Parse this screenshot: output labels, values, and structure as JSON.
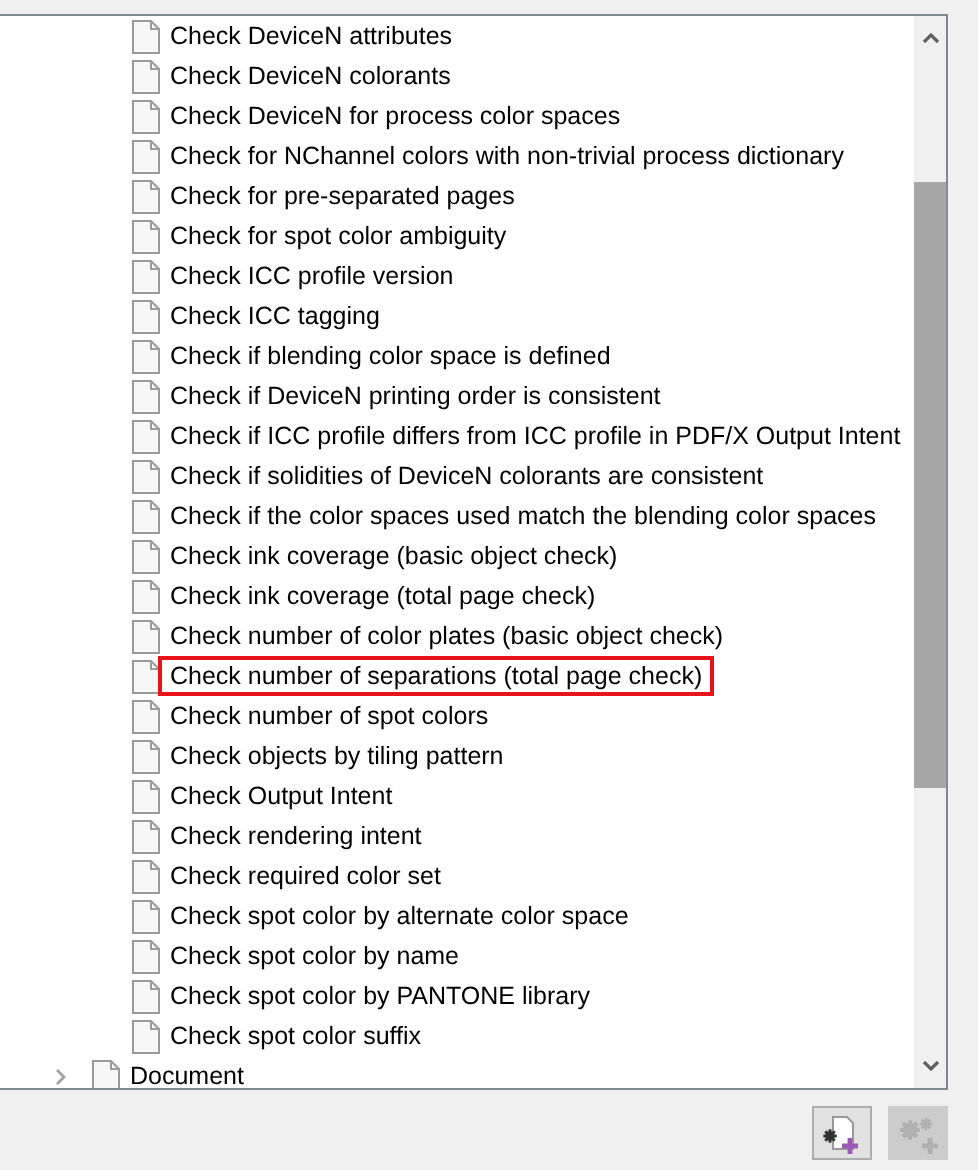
{
  "tree": {
    "items": [
      {
        "kind": "leaf",
        "label": "Check DeviceN attributes",
        "highlighted": false
      },
      {
        "kind": "leaf",
        "label": "Check DeviceN colorants",
        "highlighted": false
      },
      {
        "kind": "leaf",
        "label": "Check DeviceN for process color spaces",
        "highlighted": false
      },
      {
        "kind": "leaf",
        "label": "Check for NChannel colors with non-trivial process dictionary",
        "highlighted": false
      },
      {
        "kind": "leaf",
        "label": "Check for pre-separated pages",
        "highlighted": false
      },
      {
        "kind": "leaf",
        "label": "Check for spot color ambiguity",
        "highlighted": false
      },
      {
        "kind": "leaf",
        "label": "Check ICC profile version",
        "highlighted": false
      },
      {
        "kind": "leaf",
        "label": "Check ICC tagging",
        "highlighted": false
      },
      {
        "kind": "leaf",
        "label": "Check if blending color space is defined",
        "highlighted": false
      },
      {
        "kind": "leaf",
        "label": "Check if DeviceN printing order is consistent",
        "highlighted": false
      },
      {
        "kind": "leaf",
        "label": "Check if ICC profile differs from ICC profile in PDF/X Output Intent",
        "highlighted": false
      },
      {
        "kind": "leaf",
        "label": "Check if solidities of DeviceN colorants are consistent",
        "highlighted": false
      },
      {
        "kind": "leaf",
        "label": "Check if the color spaces used match the blending color spaces",
        "highlighted": false
      },
      {
        "kind": "leaf",
        "label": "Check ink coverage (basic object check)",
        "highlighted": false
      },
      {
        "kind": "leaf",
        "label": "Check ink coverage (total page check)",
        "highlighted": false
      },
      {
        "kind": "leaf",
        "label": "Check number of color plates (basic object check)",
        "highlighted": false
      },
      {
        "kind": "leaf",
        "label": "Check number of separations (total page check)",
        "highlighted": true
      },
      {
        "kind": "leaf",
        "label": "Check number of spot colors",
        "highlighted": false
      },
      {
        "kind": "leaf",
        "label": "Check objects by tiling pattern",
        "highlighted": false
      },
      {
        "kind": "leaf",
        "label": "Check Output Intent",
        "highlighted": false
      },
      {
        "kind": "leaf",
        "label": "Check rendering intent",
        "highlighted": false
      },
      {
        "kind": "leaf",
        "label": "Check required color set",
        "highlighted": false
      },
      {
        "kind": "leaf",
        "label": "Check spot color by alternate color space",
        "highlighted": false
      },
      {
        "kind": "leaf",
        "label": "Check spot color by name",
        "highlighted": false
      },
      {
        "kind": "leaf",
        "label": "Check spot color by PANTONE library",
        "highlighted": false
      },
      {
        "kind": "leaf",
        "label": "Check spot color suffix",
        "highlighted": false
      },
      {
        "kind": "group",
        "label": "Document",
        "expanded": false,
        "highlighted": false
      }
    ]
  },
  "buttons": [
    {
      "kind": "new-check",
      "disabled": false
    },
    {
      "kind": "settings",
      "disabled": true
    }
  ]
}
